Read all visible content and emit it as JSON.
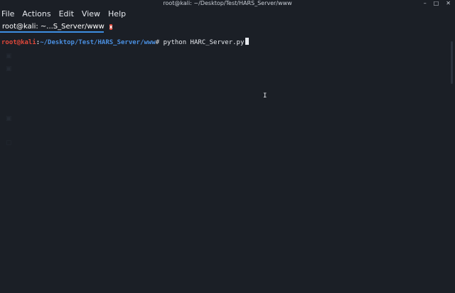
{
  "window": {
    "title": "root@kali: ~/Desktop/Test/HARS_Server/www",
    "controls": [
      "–",
      "□",
      "✕"
    ]
  },
  "menu": [
    "File",
    "Actions",
    "Edit",
    "View",
    "Help"
  ],
  "tab": {
    "label": "root@kali: ~...S_Server/www",
    "close": "x"
  },
  "terminal": {
    "prompt_user": "root@kali",
    "prompt_sep": ":",
    "prompt_path": "~/Desktop/Test/HARS_Server/www",
    "prompt_symbol": "# ",
    "command": "python HARC_Server.py"
  },
  "colors": {
    "background": "#1b1f26",
    "prompt_user": "#e0483a",
    "prompt_path": "#4a8fe0",
    "tab_accent": "#3d8ee2",
    "close_button": "#e0483a"
  }
}
